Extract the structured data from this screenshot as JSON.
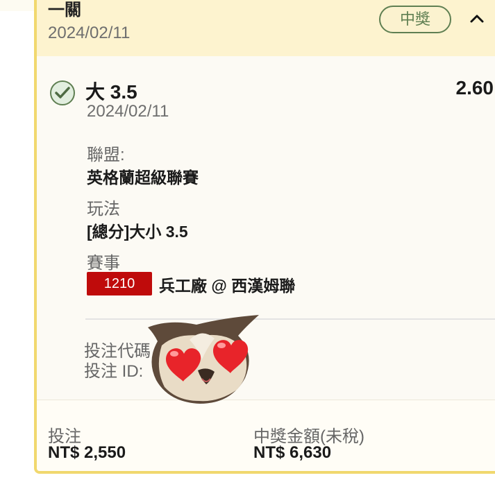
{
  "header": {
    "title": "一關",
    "date": "2024/02/11",
    "status_badge": "中獎"
  },
  "selection": {
    "name": "大 3.5",
    "date": "2024/02/11",
    "odds": "2.60"
  },
  "details": {
    "league_label": "聯盟:",
    "league_value": "英格蘭超級聯賽",
    "bet_type_label": "玩法",
    "bet_type_value": "[總分]大小 3.5",
    "event_label": "賽事",
    "match_number": "1210",
    "match_name": "兵工廠 @ 西漢姆聯"
  },
  "codes": {
    "bet_code_label": "投注代碼",
    "bet_id_label": "投注 ID:"
  },
  "footer": {
    "stake_label": "投注",
    "stake_value": "NT$ 2,550",
    "payout_label": "中獎金額(未稅)",
    "payout_value": "NT$ 6,630"
  },
  "icons": {
    "check": "check-circle-icon",
    "collapse": "chevron-up-icon",
    "overlay": "owl-heart-eyes-sticker"
  },
  "colors": {
    "accent_border": "#f1d86e",
    "badge_green": "#5f7f52",
    "match_red": "#bf0b0b",
    "header_bg": "#fdf3cf"
  }
}
